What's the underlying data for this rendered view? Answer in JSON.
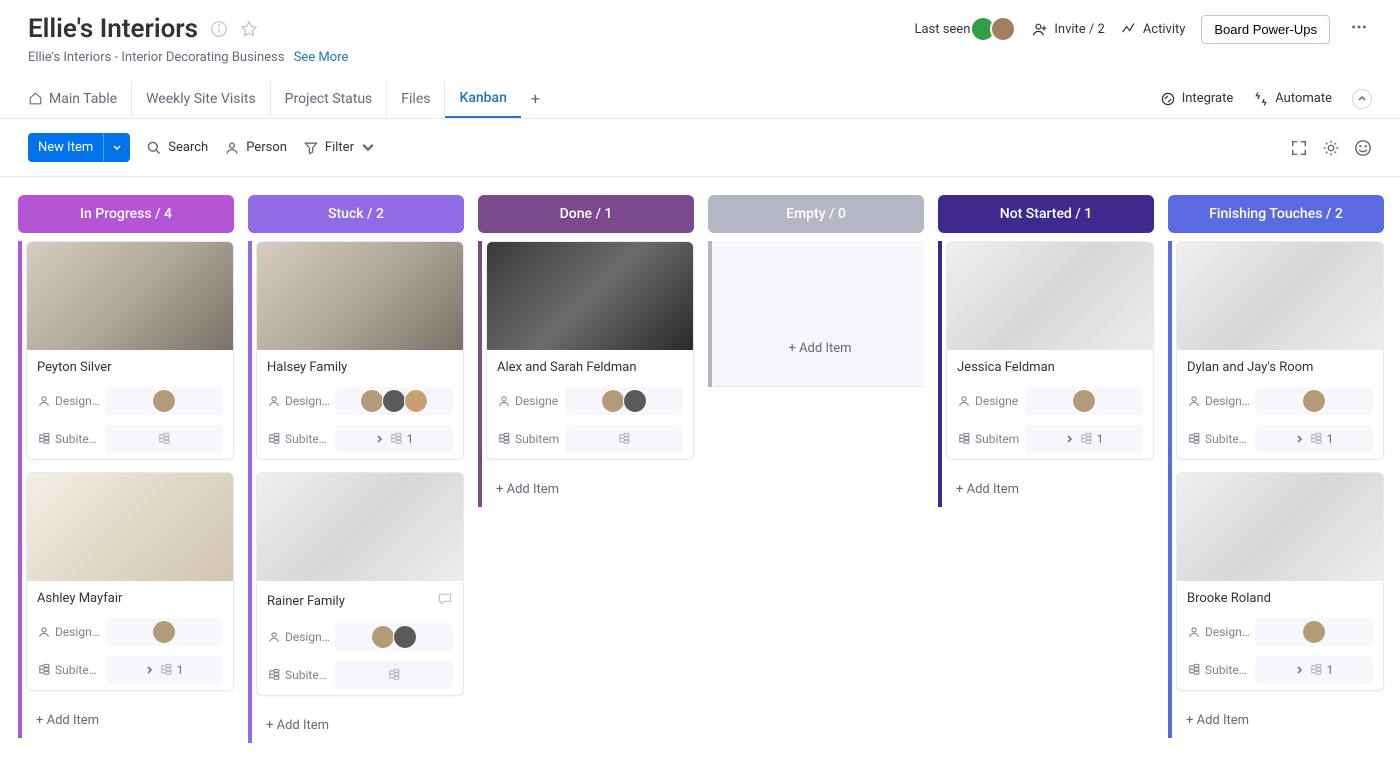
{
  "header": {
    "title": "Ellie's Interiors",
    "subtitle": "Ellie's Interiors - Interior Decorating Business",
    "see_more": "See More",
    "last_seen": "Last seen",
    "invite": "Invite / 2",
    "activity": "Activity",
    "powerups": "Board Power-Ups"
  },
  "views": {
    "main_table": "Main Table",
    "weekly": "Weekly Site Visits",
    "project_status": "Project Status",
    "files": "Files",
    "kanban": "Kanban"
  },
  "toolbar": {
    "new_item": "New Item",
    "search": "Search",
    "person": "Person",
    "filter": "Filter"
  },
  "actions": {
    "integrate": "Integrate",
    "automate": "Automate"
  },
  "labels": {
    "designer_full": "Designer",
    "designer": "Design…",
    "subitems_full": "Subitems",
    "subitems": "Subite…",
    "add_item": "+ Add Item"
  },
  "columns": [
    {
      "title": "In Progress / 4",
      "color": "#b355d4",
      "border": "#b355d4",
      "cards": [
        {
          "name": "Peyton Silver",
          "img": "var1",
          "avatars": 1,
          "sub_count": null
        },
        {
          "name": "Ashley Mayfair",
          "img": "var4",
          "avatars": 1,
          "sub_count": 1
        }
      ]
    },
    {
      "title": "Stuck / 2",
      "color": "#8f6ce6",
      "border": "#8f6ce6",
      "cards": [
        {
          "name": "Halsey Family",
          "img": "var1",
          "avatars": 3,
          "sub_count": 1
        },
        {
          "name": "Rainer Family",
          "img": "var3",
          "avatars": 2,
          "sub_count": null,
          "chat": true
        }
      ]
    },
    {
      "title": "Done / 1",
      "color": "#7a4a8c",
      "border": "#7a4a8c",
      "wide": true,
      "cards": [
        {
          "name": "Alex and Sarah Feldman",
          "img": "var2",
          "avatars": 2,
          "sub_count": null,
          "widelabel": true
        }
      ]
    },
    {
      "title": "Empty / 0",
      "color": "#b5b8c4",
      "border": "#b5b8c4",
      "empty": true,
      "cards": []
    },
    {
      "title": "Not Started / 1",
      "color": "#3d2a8c",
      "border": "#3d2a8c",
      "wide": true,
      "cards": [
        {
          "name": "Jessica Feldman",
          "img": "var3",
          "avatars": 1,
          "sub_count": 1,
          "widelabel": true
        }
      ]
    },
    {
      "title": "Finishing Touches / 2",
      "color": "#5a6ae0",
      "border": "#5a6ae0",
      "cards": [
        {
          "name": "Dylan and Jay's Room",
          "img": "var3",
          "avatars": 1,
          "sub_count": 1
        },
        {
          "name": "Brooke Roland",
          "img": "var3",
          "avatars": 1,
          "sub_count": 1
        }
      ]
    }
  ]
}
